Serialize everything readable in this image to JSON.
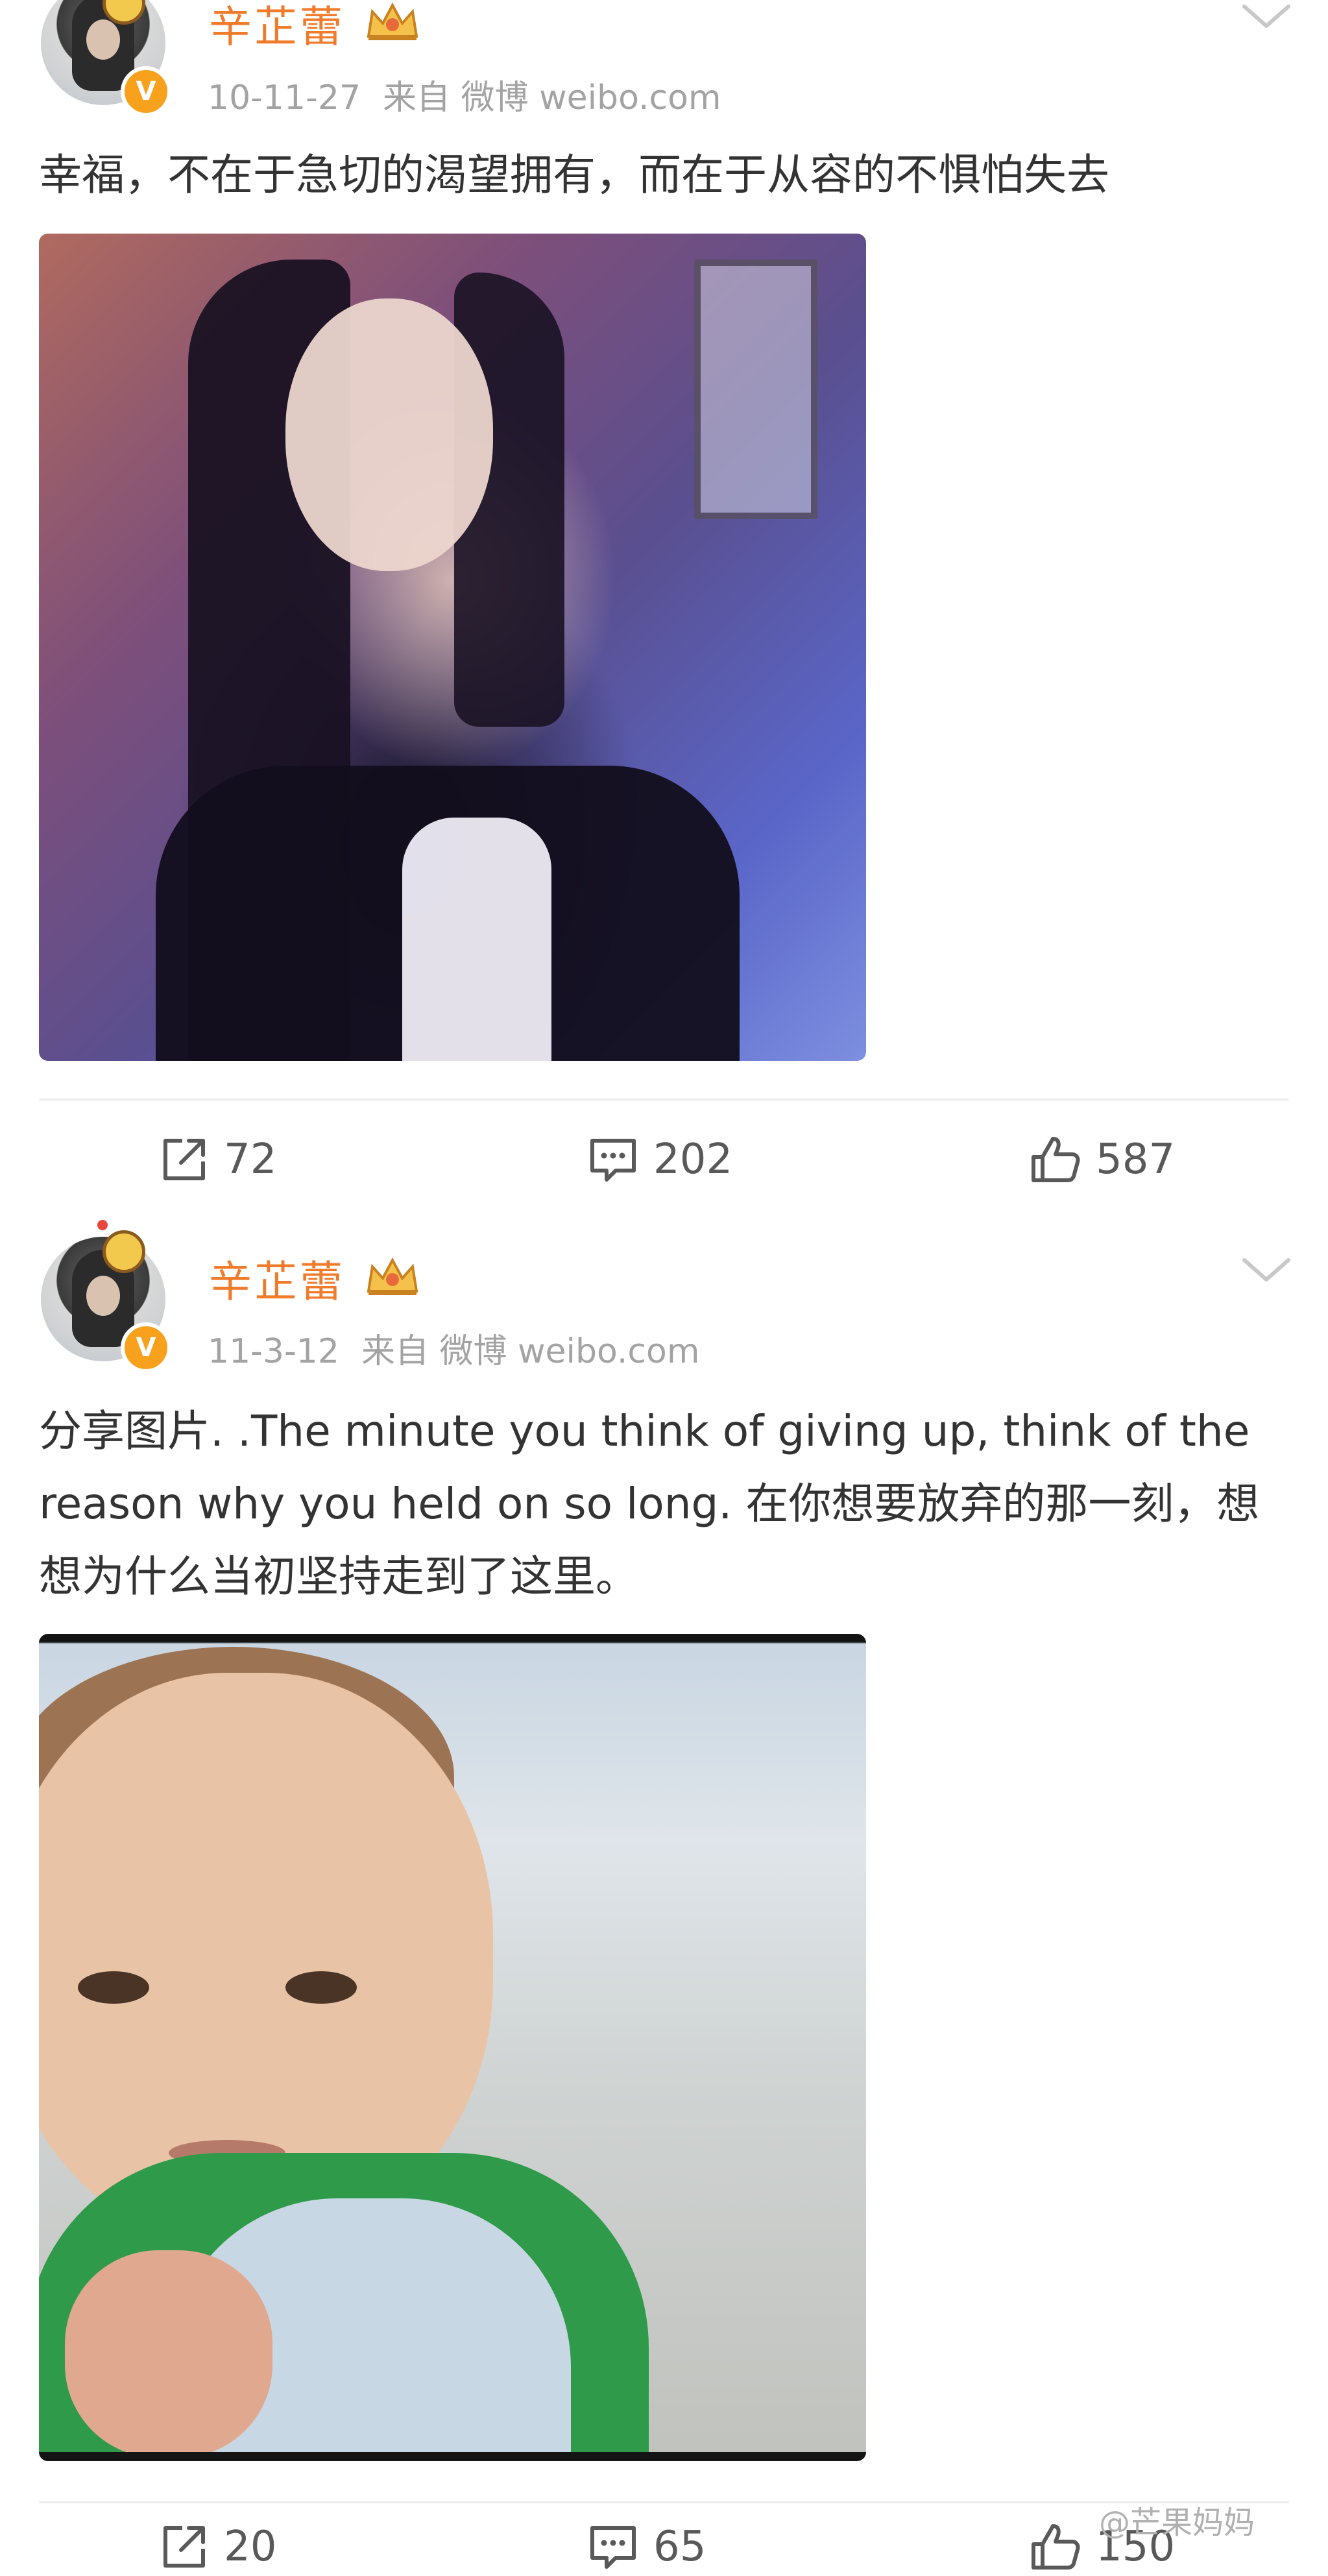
{
  "posts": [
    {
      "username": "辛芷蕾",
      "date": "10-11-27",
      "source": "来自 微博 weibo.com",
      "text": "幸福，不在于急切的渴望拥有，而在于从容的不惧怕失去",
      "actions": {
        "repost_count": "72",
        "comment_count": "202",
        "like_count": "587"
      }
    },
    {
      "username": "辛芷蕾",
      "date": "11-3-12",
      "source": "来自 微博 weibo.com",
      "text": "分享图片. .The minute you think of giving up, think of the reason why you held on so long. 在你想要放弃的那一刻，想想为什么当初坚持走到了这里。",
      "actions": {
        "repost_count": "20",
        "comment_count": "65",
        "like_count": "150"
      }
    }
  ],
  "watermark": "@芒果妈妈",
  "icons": {
    "verified": "verified-v-icon",
    "crown": "crown-icon",
    "more": "chevron-down-icon",
    "repost": "repost-icon",
    "comment": "comment-icon",
    "like": "thumbs-up-icon"
  },
  "colors": {
    "username": "#f07b2b",
    "meta": "#a3a3a3",
    "text": "#333333",
    "verified_badge": "#f7a11d",
    "action_text": "#595959"
  }
}
